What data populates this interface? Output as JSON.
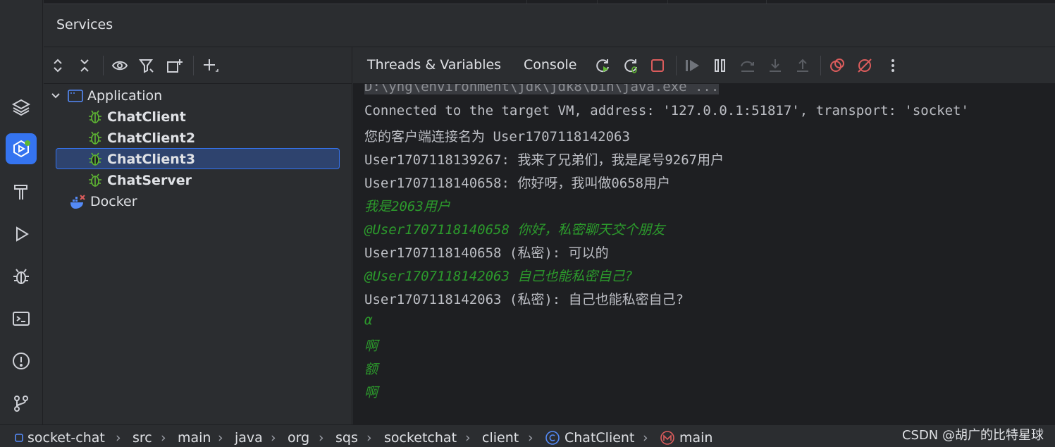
{
  "panel": {
    "title": "Services"
  },
  "tree": [
    {
      "label": "Application",
      "kind": "group",
      "icon": "application-icon"
    },
    {
      "label": "ChatClient",
      "kind": "debug-config",
      "icon": "bug-icon"
    },
    {
      "label": "ChatClient2",
      "kind": "debug-config",
      "icon": "bug-icon"
    },
    {
      "label": "ChatClient3",
      "kind": "debug-config",
      "icon": "bug-icon",
      "selected": true
    },
    {
      "label": "ChatServer",
      "kind": "debug-config",
      "icon": "bug-icon"
    },
    {
      "label": "Docker",
      "kind": "group",
      "icon": "docker-icon"
    }
  ],
  "tabs": {
    "threads": "Threads & Variables",
    "console": "Console"
  },
  "console": {
    "cmd": "D:\\yng\\environment\\jdk\\jdk8\\bin\\java.exe ...",
    "lines": [
      {
        "text": "Connected to the target VM, address: '127.0.0.1:51817', transport: 'socket'",
        "type": "out"
      },
      {
        "text": "您的客户端连接名为 User1707118142063",
        "type": "out"
      },
      {
        "text": "User1707118139267: 我来了兄弟们，我是尾号9267用户",
        "type": "out"
      },
      {
        "text": "User1707118140658: 你好呀，我叫做0658用户",
        "type": "out"
      },
      {
        "text": "我是2063用户",
        "type": "input"
      },
      {
        "text": "@User1707118140658 你好，私密聊天交个朋友",
        "type": "input"
      },
      {
        "text": "User1707118140658 (私密): 可以的",
        "type": "out"
      },
      {
        "text": "@User1707118142063 自己也能私密自己?",
        "type": "input"
      },
      {
        "text": "User1707118142063 (私密): 自己也能私密自己?",
        "type": "out"
      },
      {
        "text": "α",
        "type": "input"
      },
      {
        "text": "啊",
        "type": "input"
      },
      {
        "text": "额",
        "type": "input"
      },
      {
        "text": "啊",
        "type": "input"
      }
    ]
  },
  "breadcrumb": [
    "socket-chat",
    "src",
    "main",
    "java",
    "org",
    "sqs",
    "socketchat",
    "client",
    "ChatClient",
    "main"
  ],
  "watermark": "CSDN @胡广的比特星球",
  "colors": {
    "accent": "#3574f0",
    "input_green": "#2c9b2c",
    "stop_red": "#db5c5c"
  }
}
